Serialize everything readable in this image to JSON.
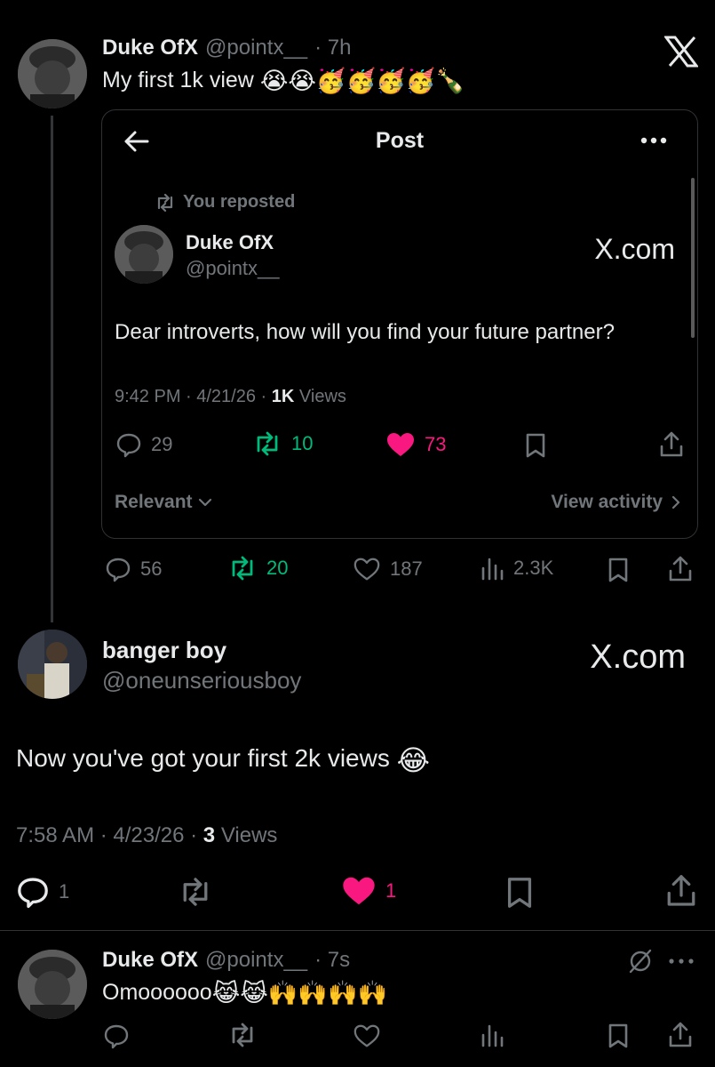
{
  "post1": {
    "name": "Duke OfX",
    "handle": "@pointx__",
    "time": "· 7h",
    "text": "My first 1k view",
    "emojis": "😭😭🥳🥳🥳🥳🍾",
    "actions": {
      "replies": "56",
      "reposts": "20",
      "likes": "187",
      "views": "2.3K"
    }
  },
  "embed": {
    "header_title": "Post",
    "reposted_label": "You reposted",
    "name": "Duke OfX",
    "handle": "@pointx__",
    "watermark": "X.com",
    "text": "Dear introverts, how will you find your future partner?",
    "meta_prefix": "9:42 PM · 4/21/26 · ",
    "meta_views_count": "1K",
    "meta_views_label": " Views",
    "actions": {
      "replies": "29",
      "reposts": "10",
      "likes": "73"
    },
    "sort_label": "Relevant",
    "view_activity_label": "View activity"
  },
  "reply": {
    "name": "banger boy",
    "handle": "@oneunseriousboy",
    "watermark": "X.com",
    "text": "Now you've got your first 2k views",
    "emoji": "😂",
    "meta_prefix": "7:58 AM · 4/23/26 · ",
    "meta_views_count": "3",
    "meta_views_label": " Views",
    "actions": {
      "replies": "1",
      "likes": "1"
    }
  },
  "post3": {
    "name": "Duke OfX",
    "handle": "@pointx__",
    "time": "· 7s",
    "text": "Omoooooo",
    "emojis": "😹😹🙌🙌🙌🙌"
  },
  "colors": {
    "background": "#000000",
    "text": "#e7e9ea",
    "muted": "#71767b",
    "repost_green": "#00ba7c",
    "like_pink": "#f91880"
  },
  "icons": [
    "x-logo",
    "back-arrow-icon",
    "more-icon",
    "repost-icon",
    "reply-icon",
    "like-icon",
    "bookmark-icon",
    "share-icon",
    "views-icon",
    "grok-icon"
  ]
}
